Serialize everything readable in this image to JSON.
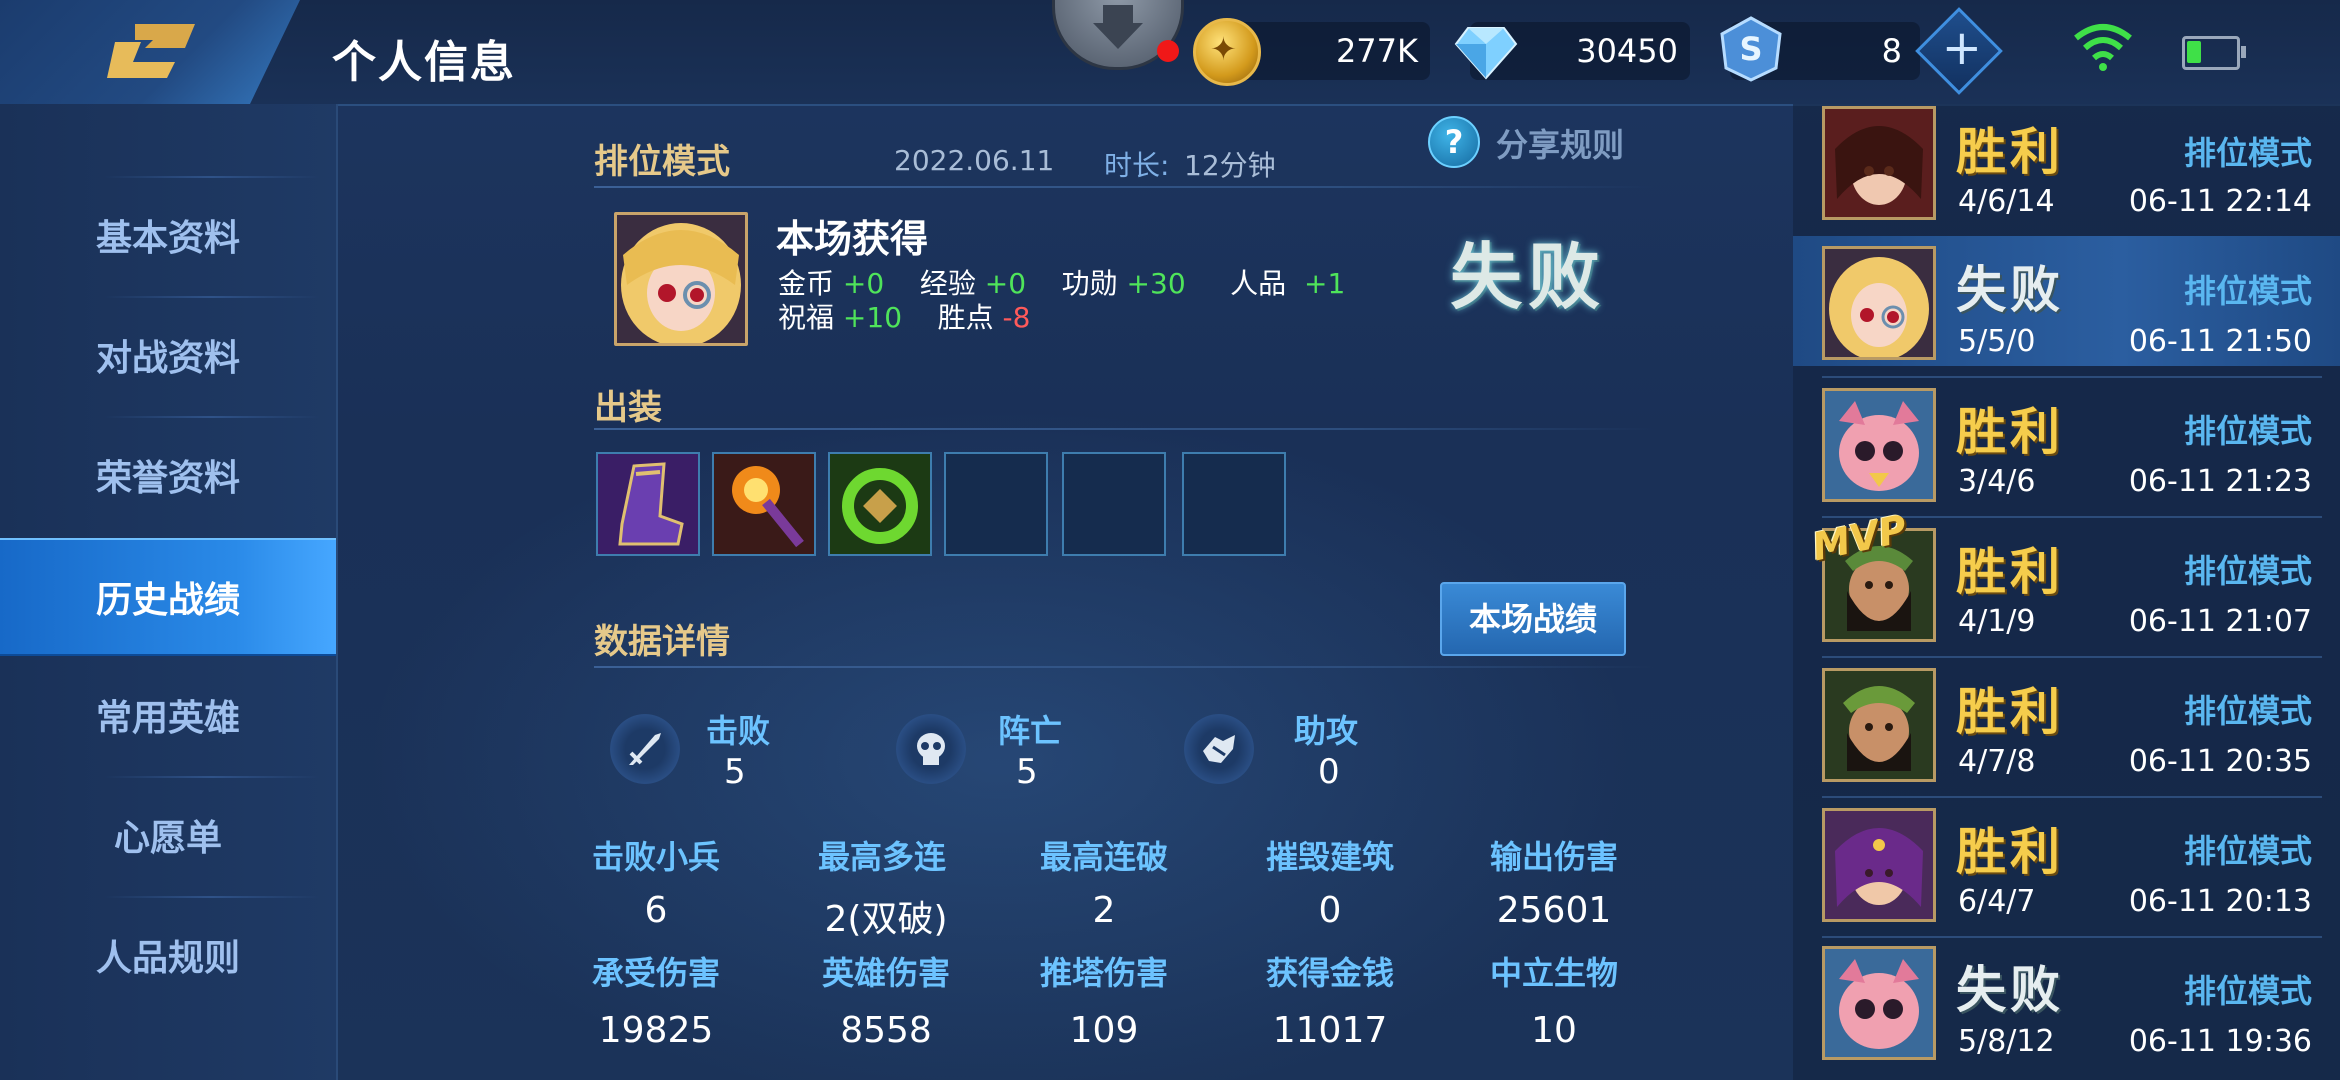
{
  "header": {
    "title": "个人信息",
    "coins": "277K",
    "diamonds": "30450",
    "tokens": "8",
    "icons": [
      "back-arrow-icon",
      "coin-icon",
      "diamond-icon",
      "token-icon",
      "plus-icon",
      "wifi-icon",
      "battery-icon"
    ]
  },
  "sidebar": {
    "items": [
      {
        "label": "基本资料"
      },
      {
        "label": "对战资料"
      },
      {
        "label": "荣誉资料"
      },
      {
        "label": "历史战绩",
        "active": true
      },
      {
        "label": "常用英雄"
      },
      {
        "label": "心愿单"
      },
      {
        "label": "人品规则"
      }
    ]
  },
  "match": {
    "mode": "排位模式",
    "date": "2022.06.11",
    "duration_label": "时长:",
    "duration": "12分钟",
    "share_rules": "分享规则",
    "gains_title": "本场获得",
    "gains": {
      "gold_label": "金币",
      "gold": "+0",
      "exp_label": "经验",
      "exp": "+0",
      "merit_label": "功勋",
      "merit": "+30",
      "credit_label": "人品",
      "credit": "+1",
      "bless_label": "祝福",
      "bless": "+10",
      "star_label": "胜点",
      "star": "-8"
    },
    "result": "失败",
    "equipment_title": "出装",
    "equipment": [
      "boots",
      "staff",
      "ring",
      "",
      "",
      ""
    ],
    "details_title": "数据详情",
    "match_record_button": "本场战绩",
    "kda": [
      {
        "label": "击败",
        "value": "5",
        "icon": "sword-icon"
      },
      {
        "label": "阵亡",
        "value": "5",
        "icon": "skull-icon"
      },
      {
        "label": "助攻",
        "value": "0",
        "icon": "handshake-icon"
      }
    ],
    "stats": [
      {
        "label": "击败小兵",
        "value": "6"
      },
      {
        "label": "最高多连",
        "value": "2(双破)"
      },
      {
        "label": "最高连破",
        "value": "2"
      },
      {
        "label": "摧毁建筑",
        "value": "0"
      },
      {
        "label": "输出伤害",
        "value": "25601"
      },
      {
        "label": "承受伤害",
        "value": "19825"
      },
      {
        "label": "英雄伤害",
        "value": "8558"
      },
      {
        "label": "推塔伤害",
        "value": "109"
      },
      {
        "label": "获得金钱",
        "value": "11017"
      },
      {
        "label": "中立生物",
        "value": "10"
      }
    ]
  },
  "history": [
    {
      "result": "胜利",
      "win": true,
      "mode": "排位模式",
      "kda": "4/6/14",
      "time": "06-11 22:14"
    },
    {
      "result": "失败",
      "win": false,
      "mode": "排位模式",
      "kda": "5/5/0",
      "time": "06-11 21:50",
      "selected": true
    },
    {
      "result": "胜利",
      "win": true,
      "mode": "排位模式",
      "kda": "3/4/6",
      "time": "06-11 21:23"
    },
    {
      "result": "胜利",
      "win": true,
      "mode": "排位模式",
      "kda": "4/1/9",
      "time": "06-11 21:07",
      "mvp": "MVP"
    },
    {
      "result": "胜利",
      "win": true,
      "mode": "排位模式",
      "kda": "4/7/8",
      "time": "06-11 20:35"
    },
    {
      "result": "胜利",
      "win": true,
      "mode": "排位模式",
      "kda": "6/4/7",
      "time": "06-11 20:13"
    },
    {
      "result": "失败",
      "win": false,
      "mode": "排位模式",
      "kda": "5/8/12",
      "time": "06-11 19:36"
    }
  ],
  "colors": {
    "accent": "#2a8ae8",
    "win": "#f6cd4c",
    "gain": "#4fe45a",
    "loss": "#ff5a5a",
    "label": "#6cc3ff",
    "section": "#e6c98a"
  }
}
